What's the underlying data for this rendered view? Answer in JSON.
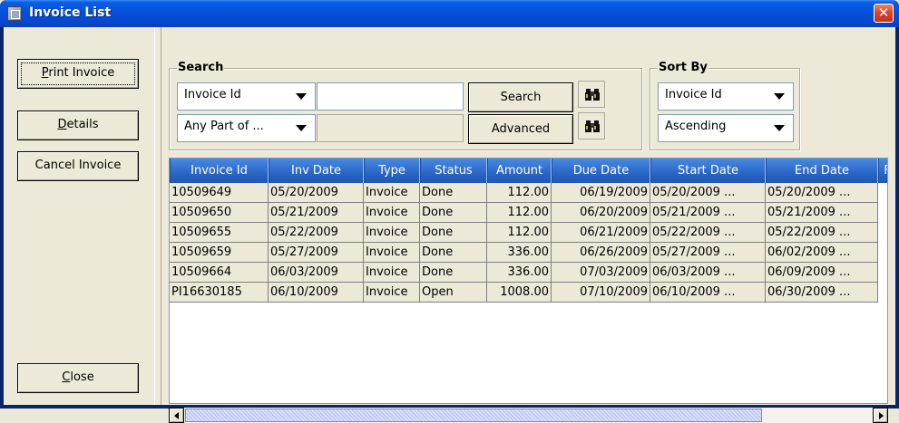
{
  "window": {
    "title": "Invoice List",
    "close_glyph": "✕"
  },
  "left_buttons": {
    "print": {
      "label": "Print Invoice",
      "mnemonic": "P",
      "rest": "rint Invoice"
    },
    "details": {
      "label": "Details",
      "mnemonic": "D",
      "rest": "etails"
    },
    "cancel": {
      "label": "Cancel Invoice"
    },
    "close": {
      "label": "Close",
      "mnemonic": "C",
      "rest": "lose"
    }
  },
  "search": {
    "title": "Search",
    "field_select": "Invoice Id",
    "match_select": "Any Part of ...",
    "search_value": "",
    "search_button": "Search",
    "advanced_button": "Advanced",
    "icon": "binoculars-icon"
  },
  "sort": {
    "title": "Sort By",
    "field_select": "Invoice Id",
    "order_select": "Ascending"
  },
  "table": {
    "headers": [
      "Invoice Id",
      "Inv Date",
      "Type",
      "Status",
      "Amount",
      "Due Date",
      "Start Date",
      "End Date",
      "F"
    ],
    "rows": [
      [
        "10509649",
        "05/20/2009",
        "Invoice",
        "Done",
        "112.00",
        "06/19/2009",
        "05/20/2009 ...",
        "05/20/2009 ..."
      ],
      [
        "10509650",
        "05/21/2009",
        "Invoice",
        "Done",
        "112.00",
        "06/20/2009",
        "05/21/2009 ...",
        "05/21/2009 ..."
      ],
      [
        "10509655",
        "05/22/2009",
        "Invoice",
        "Done",
        "112.00",
        "06/21/2009",
        "05/22/2009 ...",
        "05/22/2009 ..."
      ],
      [
        "10509659",
        "05/27/2009",
        "Invoice",
        "Done",
        "336.00",
        "06/26/2009",
        "05/27/2009 ...",
        "06/02/2009 ..."
      ],
      [
        "10509664",
        "06/03/2009",
        "Invoice",
        "Done",
        "336.00",
        "07/03/2009",
        "06/03/2009 ...",
        "06/09/2009 ..."
      ],
      [
        "PI16630185",
        "06/10/2009",
        "Invoice",
        "Open",
        "1008.00",
        "07/10/2009",
        "06/10/2009 ...",
        "06/30/2009 ..."
      ]
    ]
  },
  "colors": {
    "title_bar": "#0550d8",
    "header_blue": "#2a66c6",
    "row_bg": "#ece9d8",
    "window_bg": "#ece9d8"
  }
}
